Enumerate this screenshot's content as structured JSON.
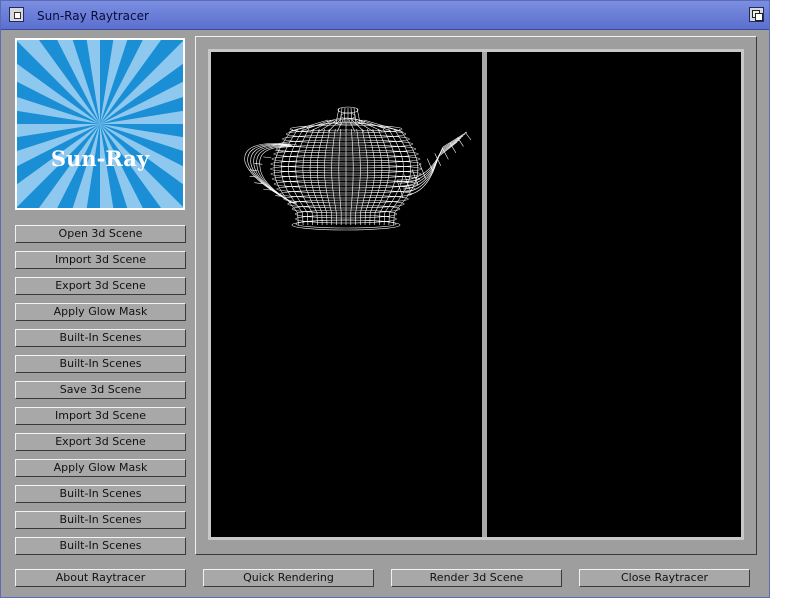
{
  "window": {
    "title": "Sun-Ray Raytracer"
  },
  "logo": {
    "text": "Sun-Ray",
    "colors": {
      "ray_dark": "#1a8fd6",
      "ray_light": "#8fc8ee",
      "text": "#ffffff"
    }
  },
  "sidebar": {
    "buttons": [
      "Open 3d Scene",
      "Import 3d Scene",
      "Export 3d Scene",
      "Apply Glow Mask",
      "Built-In Scenes",
      "Built-In Scenes",
      "Save 3d Scene",
      "Import 3d Scene",
      "Export 3d Scene",
      "Apply Glow Mask",
      "Built-In Scenes",
      "Built-In Scenes",
      "Built-In Scenes"
    ]
  },
  "footer": {
    "about": "About Raytracer",
    "quick": "Quick Rendering",
    "render": "Render 3d Scene",
    "close": "Close Raytracer"
  },
  "viewport": {
    "preview_object": "teapot-wireframe",
    "background": "#000000"
  },
  "colors": {
    "window_bg": "#9e9e9e",
    "titlebar": "#6a7ed8",
    "button_face": "#a8a8a8"
  }
}
